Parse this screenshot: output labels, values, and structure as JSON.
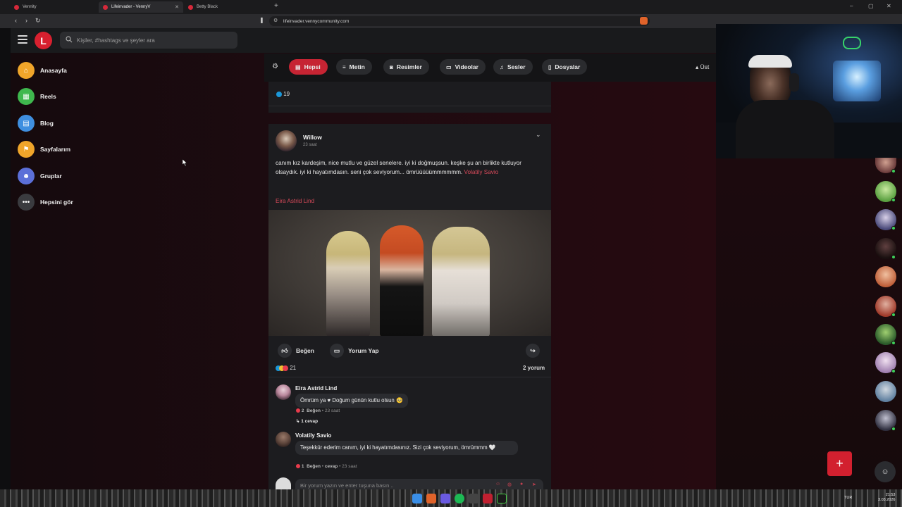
{
  "browser": {
    "tabs": [
      {
        "label": "Vennity",
        "active": false
      },
      {
        "label": "Lifeinvader - VennyV",
        "active": true
      },
      {
        "label": "Betty Black",
        "active": false
      }
    ],
    "url": "lifeinvader.vennycommunity.com"
  },
  "header": {
    "logo_letter": "L",
    "search_placeholder": "Kişiler, #hashtags ve şeyler ara"
  },
  "sidebar": {
    "items": [
      {
        "label": "Anasayfa",
        "icon": "home-icon",
        "color": "#f0a52a"
      },
      {
        "label": "Reels",
        "icon": "reels-icon",
        "color": "#3fb84e"
      },
      {
        "label": "Blog",
        "icon": "blog-icon",
        "color": "#3f8fe0"
      },
      {
        "label": "Sayfalarım",
        "icon": "flag-icon",
        "color": "#f0a52a"
      },
      {
        "label": "Gruplar",
        "icon": "group-icon",
        "color": "#5b6fd8"
      },
      {
        "label": "Hepsini gör",
        "icon": "more-icon",
        "color": "#3a3b3f"
      }
    ]
  },
  "filters": {
    "chips": [
      {
        "label": "Hepsi",
        "icon": "doc-icon",
        "active": true
      },
      {
        "label": "Metin",
        "icon": "lines-icon",
        "active": false
      },
      {
        "label": "Resimler",
        "icon": "camera-icon",
        "active": false
      },
      {
        "label": "Videolar",
        "icon": "video-icon",
        "active": false
      },
      {
        "label": "Sesler",
        "icon": "music-icon",
        "active": false
      },
      {
        "label": "Dosyalar",
        "icon": "file-icon",
        "active": false
      }
    ],
    "top_label": "Üst"
  },
  "prev_post": {
    "reaction_count": "19"
  },
  "post": {
    "author": "Willow",
    "time": "23 saat",
    "text": "canım kız kardeşim, nice mutlu ve güzel senelere. iyi ki doğmuşsun. keşke şu an birlikte kutluyor olsaydık. iyi ki hayatımdasın. seni çok seviyorum... ömrüüüüümmmmmm.",
    "mention_inline": "Volatily Savio",
    "mention_block": "Eira Astrid Lind",
    "like_label": "Beğen",
    "comment_label": "Yorum Yap",
    "reaction_count": "21",
    "comment_count": "2 yorum"
  },
  "comments": [
    {
      "author": "Eira Astrid Lind",
      "text": "Ömrüm ya ♥ Doğum günün kutlu olsun 🥺",
      "likes": "2",
      "like_label": "Beğen",
      "time": "23 saat",
      "replies": "1 cevap"
    },
    {
      "author": "Volatily Savio",
      "text": "Teşekkür ederim canım, iyi ki hayatımdasınız. Sizi çok seviyorum, ömrümmm 🤍",
      "likes": "1",
      "like_label": "Beğen",
      "reply_label": "cevap",
      "time": "23 saat"
    }
  ],
  "comment_input": {
    "placeholder": "Bir yorum yazın ve enter tuşuna basın .."
  },
  "taskbar": {
    "lang": "TUR",
    "time": "21:53",
    "date": "3.03.2026"
  }
}
